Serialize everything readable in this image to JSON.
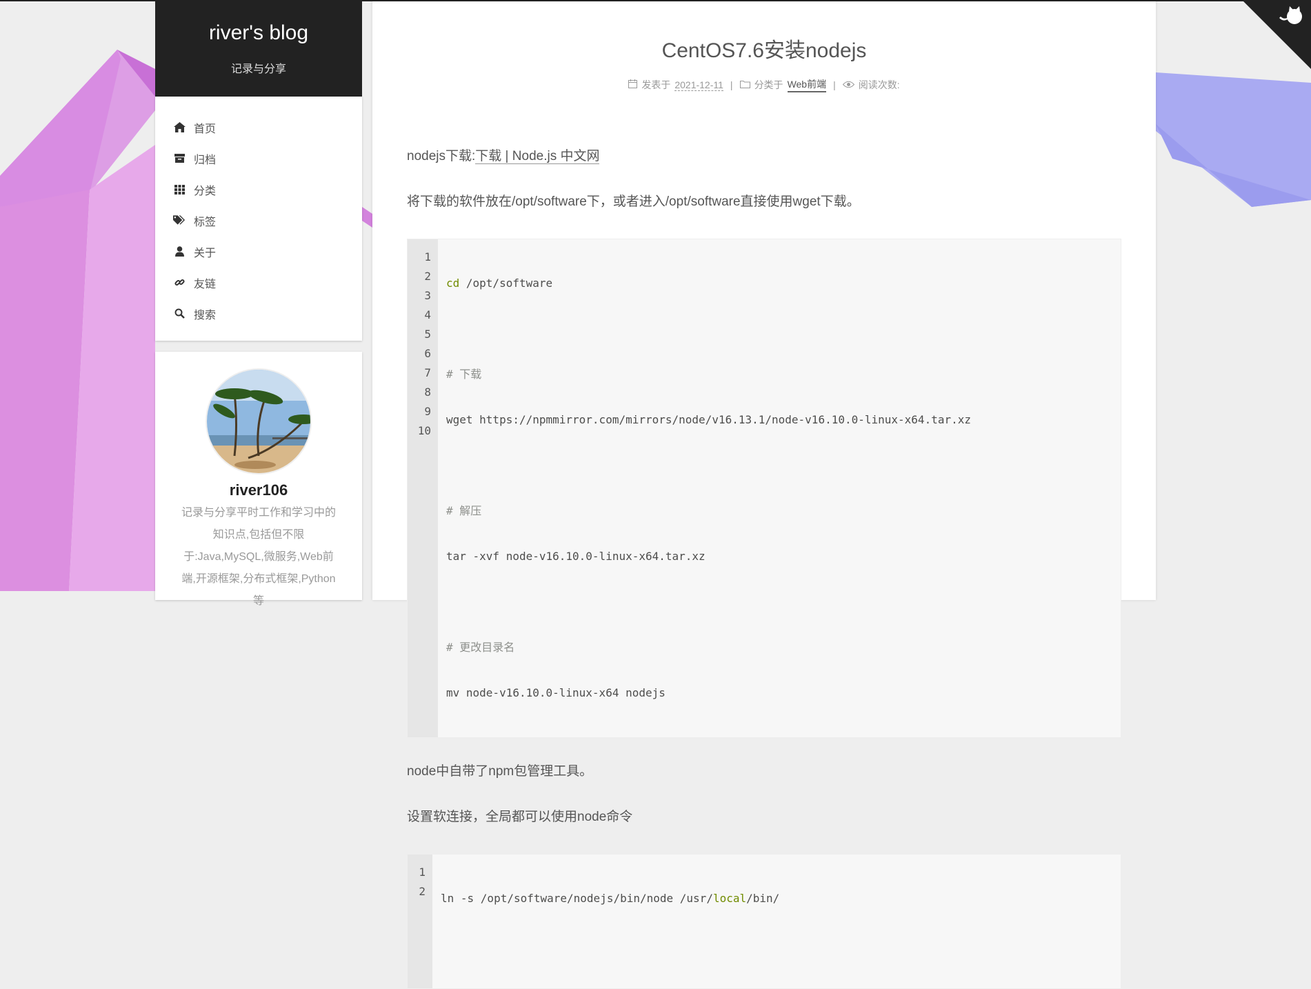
{
  "site": {
    "title": "river's blog",
    "subtitle": "记录与分享"
  },
  "menu": [
    {
      "label": "首页",
      "icon": "home-icon"
    },
    {
      "label": "归档",
      "icon": "archive-icon"
    },
    {
      "label": "分类",
      "icon": "grid-icon"
    },
    {
      "label": "标签",
      "icon": "tags-icon"
    },
    {
      "label": "关于",
      "icon": "user-icon"
    },
    {
      "label": "友链",
      "icon": "link-icon"
    },
    {
      "label": "搜索",
      "icon": "search-icon"
    }
  ],
  "profile": {
    "name": "river106",
    "description": "记录与分享平时工作和学习中的知识点,包括但不限于:Java,MySQL,微服务,Web前端,开源框架,分布式框架,Python等"
  },
  "post": {
    "title": "CentOS7.6安装nodejs",
    "meta": {
      "posted_label": "发表于",
      "date": "2021-12-11",
      "category_label": "分类于",
      "category": "Web前端",
      "views_label": "阅读次数:"
    },
    "p1_prefix": "nodejs下载:",
    "p1_link": "下载 | Node.js 中文网",
    "p2": "将下载的软件放在/opt/software下，或者进入/opt/software直接使用wget下载。",
    "code1": {
      "lines": [
        "cd /opt/software",
        "",
        "# 下载",
        "wget https://npmmirror.com/mirrors/node/v16.13.1/node-v16.10.0-linux-x64.tar.xz",
        "",
        "# 解压",
        "tar -xvf node-v16.10.0-linux-x64.tar.xz",
        "",
        "# 更改目录名",
        "mv node-v16.10.0-linux-x64 nodejs"
      ]
    },
    "p3": "node中自带了npm包管理工具。",
    "p4": "设置软连接，全局都可以使用node命令",
    "code2": {
      "lines": [
        "ln -s /opt/software/nodejs/bin/node /usr/local/bin/",
        ""
      ]
    }
  },
  "colors": {
    "sidebar_header": "#222222",
    "keyword": "#718c00",
    "comment": "#8e908c"
  }
}
